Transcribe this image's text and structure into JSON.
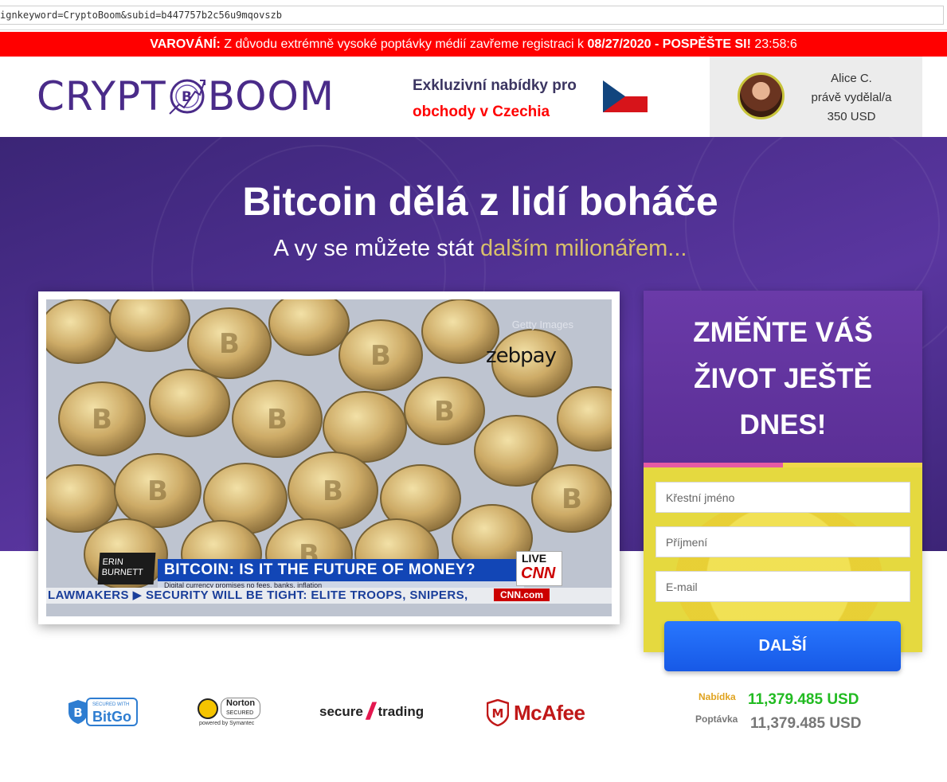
{
  "browser": {
    "url": "ignkeyword=CryptoBoom&subid=b447757b2c56u9mqovszb"
  },
  "warning": {
    "label": "VAROVÁNÍ:",
    "text": " Z důvodu extrémně vysoké poptávky médií zavřeme registraci k ",
    "date": "08/27/2020",
    "cta": " - POSPĚŠTE SI!",
    "countdown": " 23:58:6"
  },
  "header": {
    "logo_left": "CRYPT",
    "logo_right": "BOOM",
    "offer_line1": "Exkluzivní nabídky pro",
    "offer_line2": "obchody v Czechia",
    "earner_name": "Alice C.",
    "earner_action": "právě vydělal/a",
    "earner_amount": "350 USD"
  },
  "hero": {
    "title": "Bitcoin dělá z lidí boháče",
    "subtitle_plain": "A vy se můžete stát ",
    "subtitle_gold": "dalším milionářem..."
  },
  "video": {
    "watermark": "Getty Images",
    "brand": "zebpay",
    "anchor": "ERIN BURNETT",
    "headline": "BITCOIN: IS IT THE FUTURE OF MONEY?",
    "subline": "Digital currency promises no fees, banks, inflation",
    "live": "LIVE",
    "network": "CNN",
    "ticker": "LAWMAKERS  ▶  SECURITY WILL BE TIGHT: ELITE TROOPS, SNIPERS,",
    "site": "CNN.com"
  },
  "signup": {
    "title": "ZMĚŇTE VÁŠ ŽIVOT JEŠTĚ DNES!",
    "first_name_placeholder": "Křestní jméno",
    "last_name_placeholder": "Příjmení",
    "email_placeholder": "E-mail",
    "submit_label": "DALŠÍ"
  },
  "trust_badges": {
    "bitgo_small": "SECURED WITH",
    "bitgo": "BitGo",
    "norton": "Norton",
    "norton_sub": "SECURED",
    "norton_by": "powered by Symantec",
    "securetrading_left": "secure",
    "securetrading_right": "trading",
    "mcafee": "McAfee"
  },
  "stats": {
    "offer_label": "Nabídka",
    "offer_value": "11,379.485 USD",
    "demand_label": "Poptávka",
    "demand_value": "11,379.485 USD"
  },
  "colors": {
    "warning_bg": "#ff0000",
    "brand_purple": "#4a2b89",
    "button_blue": "#1f6bff",
    "form_yellow": "#e5d93f",
    "offer_green": "#22bb22"
  }
}
